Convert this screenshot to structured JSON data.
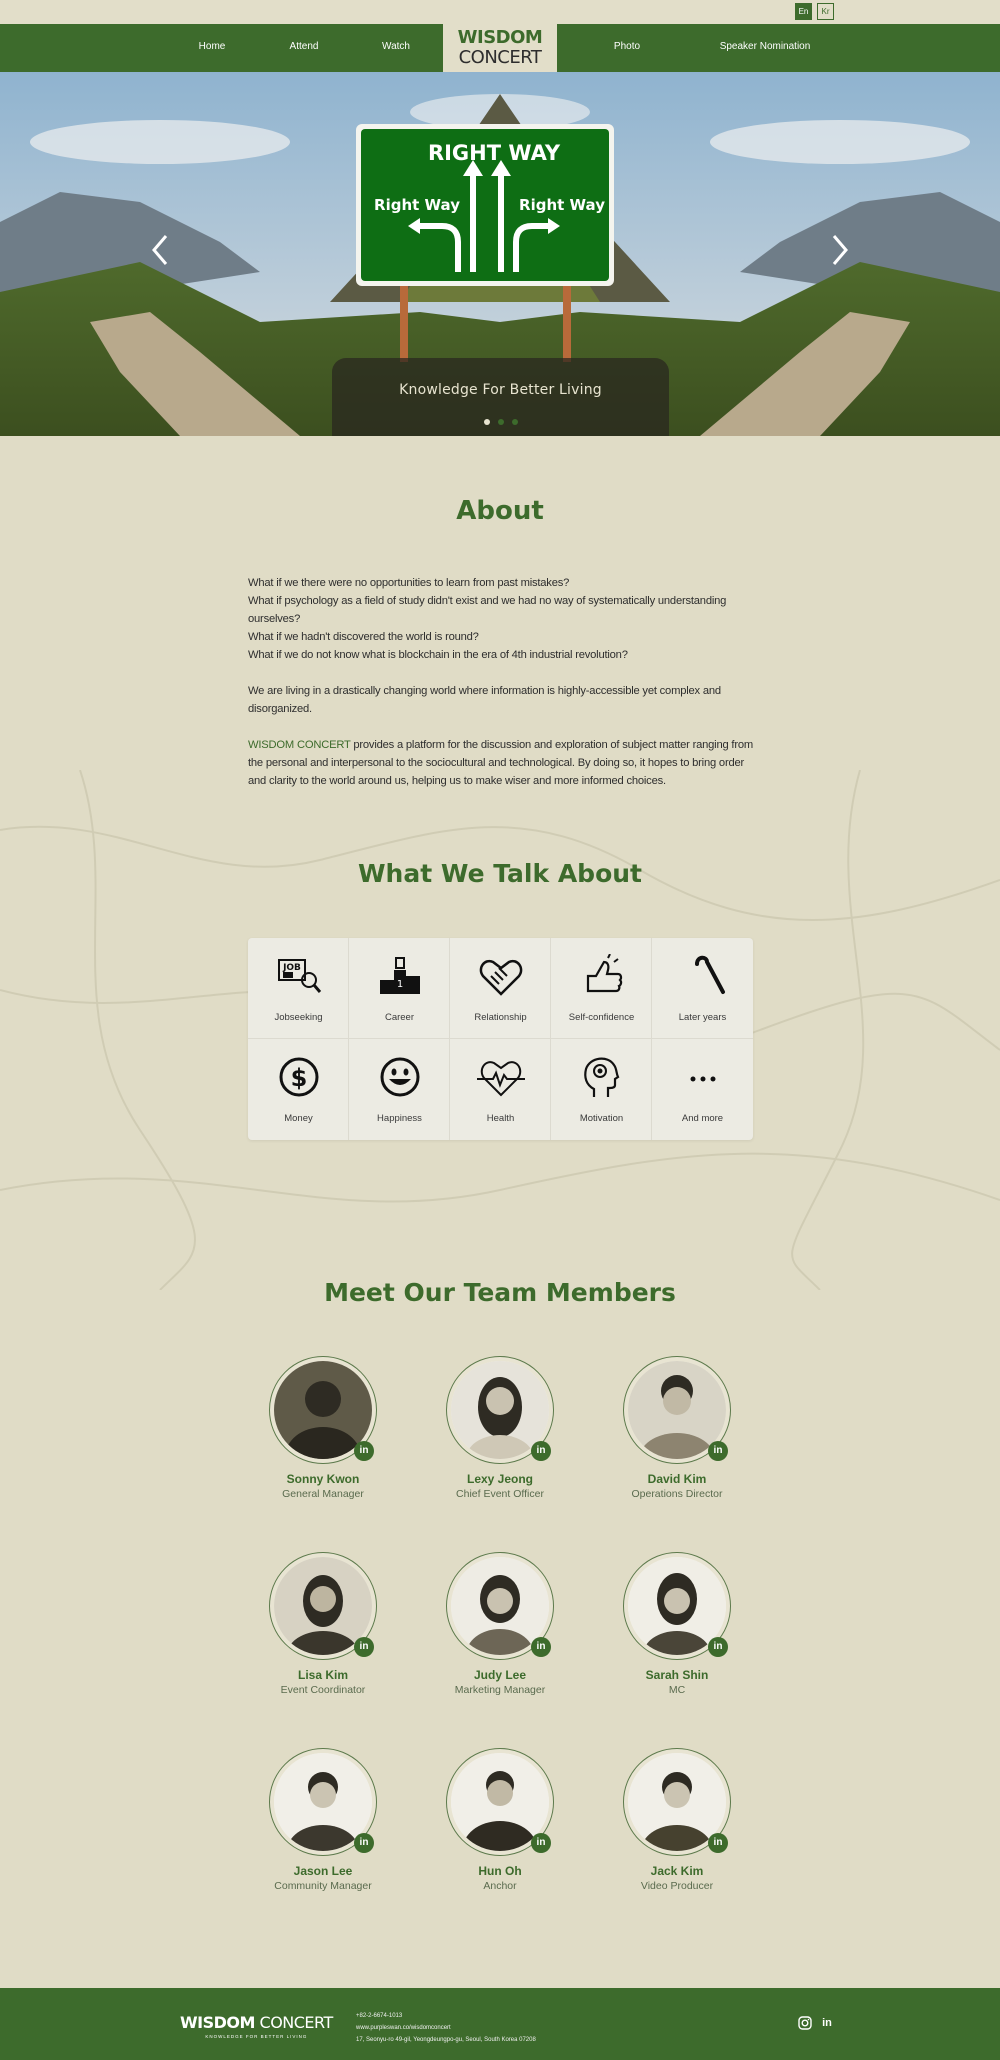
{
  "lang": {
    "en": "En",
    "kr": "Kr"
  },
  "nav": {
    "home": "Home",
    "attend": "Attend",
    "watch": "Watch",
    "photo": "Photo",
    "speaker": "Speaker Nomination"
  },
  "logo": {
    "line1": "WISDOM",
    "line2": "CONCERT"
  },
  "hero": {
    "sign_title": "RIGHT WAY",
    "sign_left": "Right Way",
    "sign_right": "Right Way",
    "caption": "Knowledge For Better Living",
    "slide_count": 3,
    "active_slide": 1
  },
  "about": {
    "title": "About",
    "questions": [
      "What if we there were no opportunities to learn from past mistakes?",
      "What if psychology as a field of study didn't exist and we had no way of systematically understanding ourselves?",
      "What if we hadn't discovered the world is round?",
      "What if we do not know what is blockchain in the era of 4th industrial revolution?"
    ],
    "para1": "We are living in a drastically changing world where information is highly-accessible yet complex and disorganized.",
    "brand": "WISDOM CONCERT",
    "para2": " provides a platform for the discussion and exploration of subject matter ranging from the personal and interpersonal to the sociocultural and technological. By doing so, it hopes to bring order and clarity to the world around us, helping us to make wiser and more informed choices."
  },
  "talk": {
    "title": "What We Talk About",
    "topics": [
      {
        "label": "Jobseeking",
        "icon": "job-search-icon"
      },
      {
        "label": "Career",
        "icon": "podium-icon"
      },
      {
        "label": "Relationship",
        "icon": "handshake-icon"
      },
      {
        "label": "Self-confidence",
        "icon": "thumbs-up-icon"
      },
      {
        "label": "Later years",
        "icon": "cane-icon"
      },
      {
        "label": "Money",
        "icon": "dollar-icon"
      },
      {
        "label": "Happiness",
        "icon": "smile-icon"
      },
      {
        "label": "Health",
        "icon": "heartbeat-icon"
      },
      {
        "label": "Motivation",
        "icon": "head-icon"
      },
      {
        "label": "And more",
        "icon": "more-icon"
      }
    ]
  },
  "team": {
    "title": "Meet Our Team Members",
    "linkedin_label": "in",
    "members": [
      {
        "name": "Sonny Kwon",
        "role": "General Manager"
      },
      {
        "name": "Lexy Jeong",
        "role": "Chief Event Officer"
      },
      {
        "name": "David Kim",
        "role": "Operations Director"
      },
      {
        "name": "Lisa Kim",
        "role": "Event Coordinator"
      },
      {
        "name": "Judy Lee",
        "role": "Marketing Manager"
      },
      {
        "name": "Sarah Shin",
        "role": "MC"
      },
      {
        "name": "Jason Lee",
        "role": "Community Manager"
      },
      {
        "name": "Hun Oh",
        "role": "Anchor"
      },
      {
        "name": "Jack Kim",
        "role": "Video Producer"
      }
    ]
  },
  "footer": {
    "logo_bold": "WISDOM",
    "logo_light": " CONCERT",
    "tagline": "KNOWLEDGE FOR BETTER LIVING",
    "phone": "+82-2-6674-1013",
    "url": "www.purpleswan.co/wisdomconcert",
    "address": "17, Seonyu-ro 49-gil, Yeongdeungpo-gu, Seoul, South Korea 07208",
    "instagram_icon": "instagram-icon",
    "linkedin_label": "in"
  },
  "colors": {
    "brand_green": "#3d6b2c",
    "background": "#e0dcc6",
    "sign_green": "#0e6e14"
  }
}
